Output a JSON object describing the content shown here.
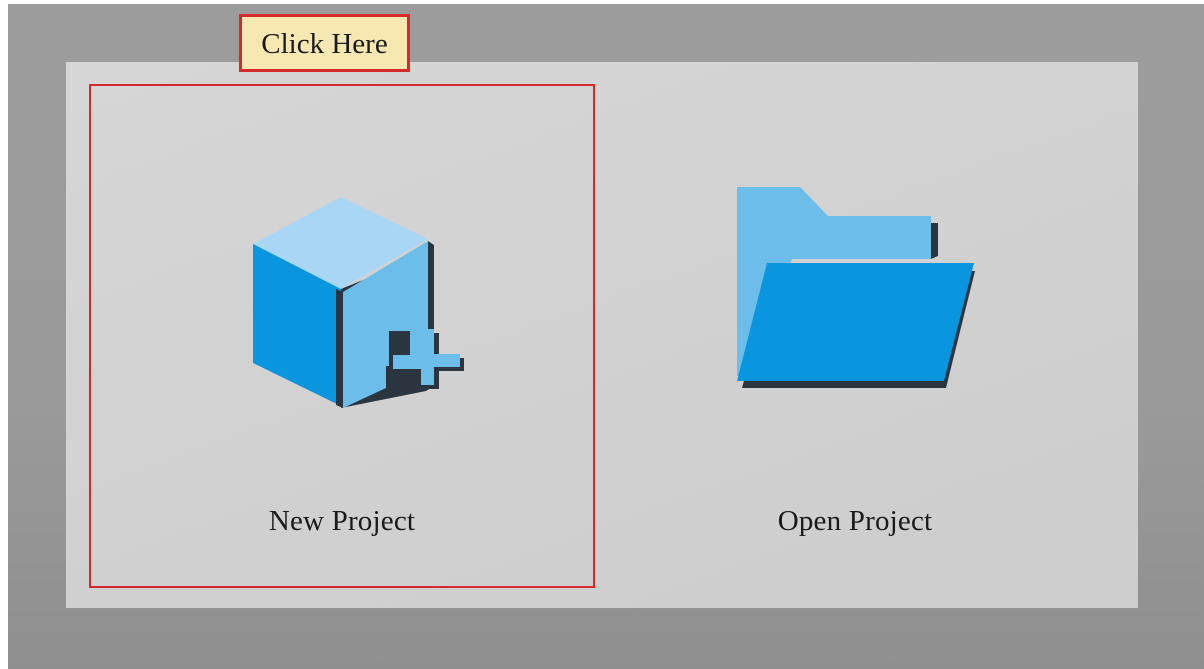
{
  "callout": {
    "text": "Click Here"
  },
  "tiles": [
    {
      "label": "New Project",
      "icon": "new-project-cube-plus-icon",
      "highlighted": true
    },
    {
      "label": "Open Project",
      "icon": "open-folder-icon",
      "highlighted": false
    }
  ],
  "colors": {
    "highlight_border": "#d42a2a",
    "callout_background": "#f7e7b0",
    "icon_light_blue": "#a9d6f5",
    "icon_mid_blue": "#6cbde9",
    "icon_dark_blue": "#0a96df",
    "icon_shadow": "#2b3540"
  }
}
